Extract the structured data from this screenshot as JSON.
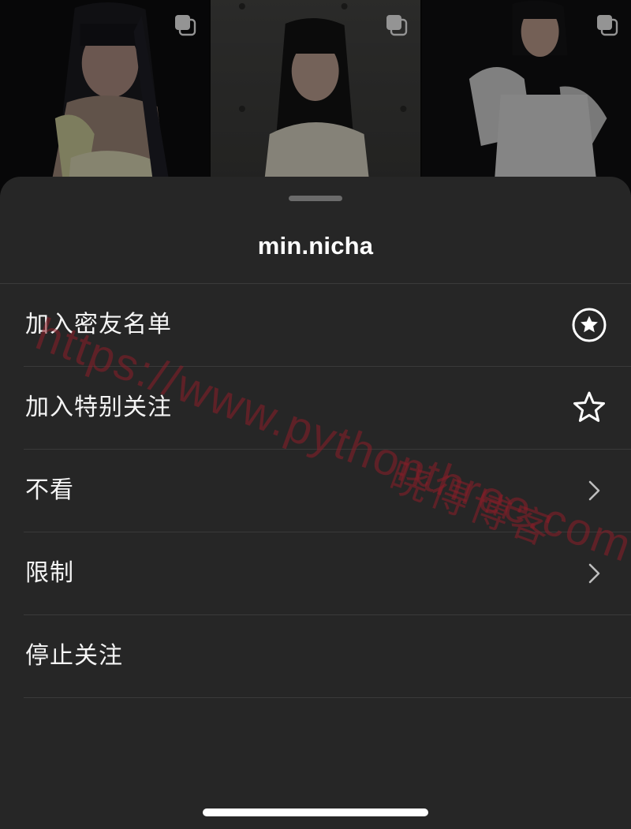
{
  "profile": {
    "username": "min.nicha"
  },
  "menu": {
    "items": [
      {
        "label": "加入密友名单",
        "icon": "close-friends-star-circle-icon"
      },
      {
        "label": "加入特别关注",
        "icon": "star-outline-icon"
      },
      {
        "label": "不看",
        "icon": "chevron-right-icon"
      },
      {
        "label": "限制",
        "icon": "chevron-right-icon"
      },
      {
        "label": "停止关注",
        "icon": ""
      }
    ]
  },
  "watermark": {
    "url": "https://www.pythonthree.com",
    "name": "晓得博客"
  },
  "colors": {
    "sheet_background": "#262626",
    "divider": "#3a3a3a",
    "text": "#ffffff",
    "watermark": "#8c1e28"
  }
}
